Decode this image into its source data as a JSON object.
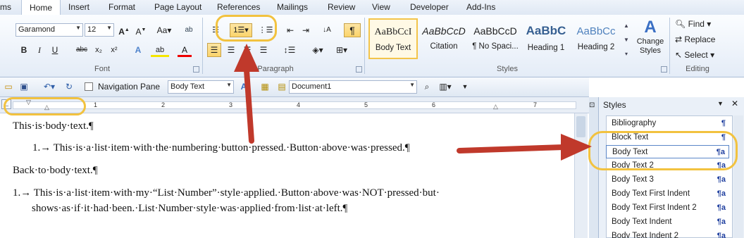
{
  "tabs": [
    "ms",
    "Home",
    "Insert",
    "Format",
    "Page Layout",
    "References",
    "Mailings",
    "Review",
    "View",
    "Developer",
    "Add-Ins"
  ],
  "font": {
    "name": "Garamond",
    "size": "12",
    "group_label": "Font"
  },
  "paragraph": {
    "group_label": "Paragraph"
  },
  "styles_gallery": {
    "group_label": "Styles",
    "items": [
      {
        "preview": "AaBbCcI",
        "name": "Body Text",
        "selected": true
      },
      {
        "preview": "AaBbCcD",
        "name": "Citation"
      },
      {
        "preview": "AaBbCcD",
        "name": "¶ No Spaci..."
      },
      {
        "preview": "AaBbC",
        "name": "Heading 1"
      },
      {
        "preview": "AaBbCc",
        "name": "Heading 2"
      }
    ],
    "change_styles": "Change Styles"
  },
  "editing": {
    "group_label": "Editing",
    "find": "Find",
    "replace": "Replace",
    "select": "Select"
  },
  "qat": {
    "navigation_pane": "Navigation Pane",
    "style_box": "Body Text",
    "document_box": "Document1"
  },
  "ruler_numbers": [
    "1",
    "2",
    "3",
    "4",
    "5",
    "6",
    "7"
  ],
  "document": {
    "line1": "This·is·body·text.¶",
    "line2": "1.→ This·is·a·list·item·with·the·numbering·button·pressed.·Button·above·was·pressed.¶",
    "line3": "Back·to·body·text.¶",
    "line4": "1.→ This·is·a·list·item·with·my·“List·Number”·style·applied.·Button·above·was·NOT·pressed·but·",
    "line5": "shows·as·if·it·had·been.·List·Number·style·was·applied·from·list·at·left.¶"
  },
  "styles_pane": {
    "title": "Styles",
    "items": [
      {
        "name": "Bibliography",
        "mark": "¶"
      },
      {
        "name": "Block Text",
        "mark": "¶"
      },
      {
        "name": "Body Text",
        "mark": "¶a",
        "selected": true
      },
      {
        "name": "Body Text 2",
        "mark": "¶a"
      },
      {
        "name": "Body Text 3",
        "mark": "¶a"
      },
      {
        "name": "Body Text First Indent",
        "mark": "¶a"
      },
      {
        "name": "Body Text First Indent 2",
        "mark": "¶a"
      },
      {
        "name": "Body Text Indent",
        "mark": "¶a"
      },
      {
        "name": "Body Text Indent 2",
        "mark": "¶a"
      }
    ]
  },
  "colors": {
    "highlight": "#f2c23f",
    "arrow": "#c0392b",
    "pressed": "#fbd46a"
  }
}
